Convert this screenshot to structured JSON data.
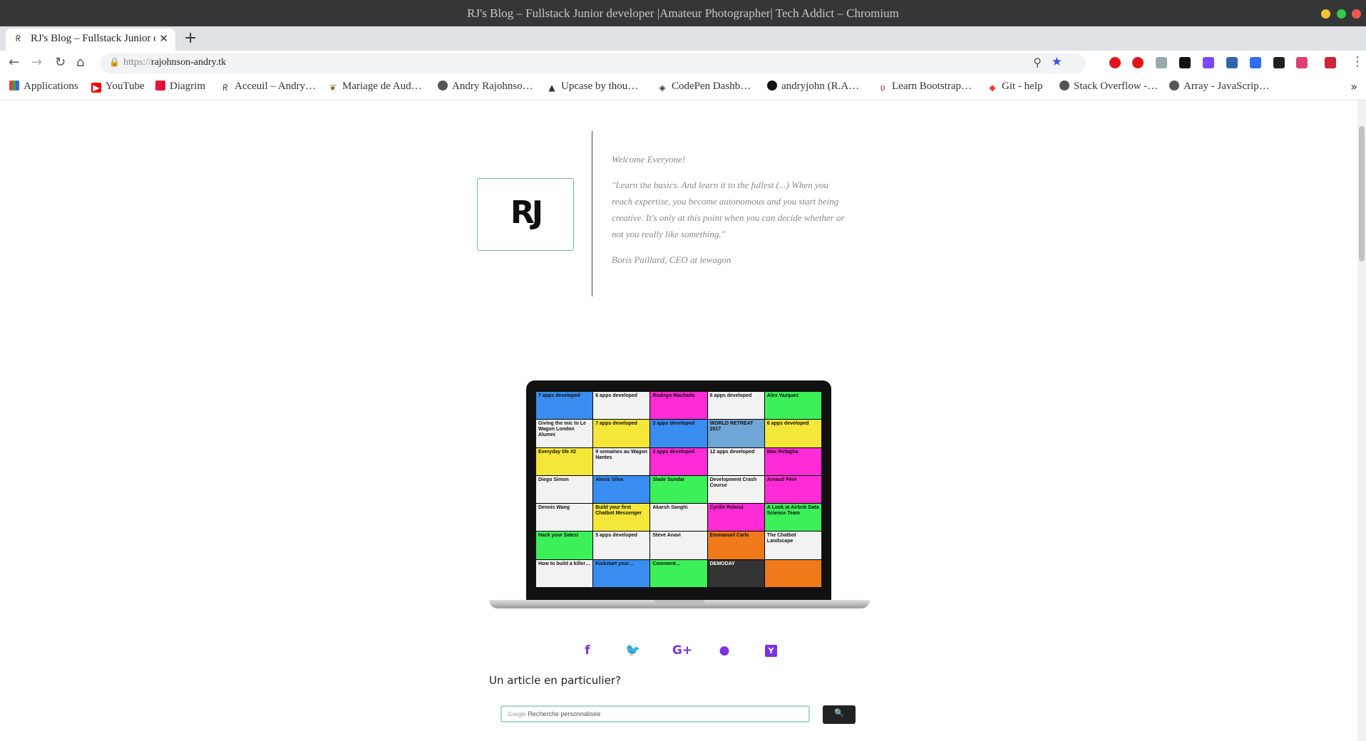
{
  "window": {
    "title": "RJ's Blog – Fullstack Junior developer  |Amateur Photographer| Tech Addict – Chromium",
    "controls": {
      "minimize_color": "#f5c12e",
      "maximize_color": "#37c84c",
      "close_color": "#f05a4c"
    }
  },
  "tab": {
    "label": "RJ's Blog – Fullstack Junior developer",
    "favicon": "rj-favicon",
    "close_icon": "close-icon",
    "new_tab_label": "+"
  },
  "toolbar": {
    "url_scheme": "https://",
    "url_host": "rajohnson-andry.tk",
    "back_glyph": "←",
    "forward_glyph": "→",
    "reload_glyph": "↻",
    "home_glyph": "⌂",
    "lock_glyph": "🔒",
    "zoom_glyph": "⚲",
    "star_glyph": "★",
    "menu_glyph": "⋮",
    "accent_color": "#3b50e0"
  },
  "bookmarks": {
    "items": [
      {
        "label": "Applications",
        "icon": "apps-grid-icon"
      },
      {
        "label": "YouTube",
        "icon": "youtube-icon"
      },
      {
        "label": "Diagrim",
        "icon": "diagrim-icon"
      },
      {
        "label": "Acceuil – Andry…",
        "icon": "rj-favicon"
      },
      {
        "label": "Mariage de Aud…",
        "icon": "leaf-icon"
      },
      {
        "label": "Andry Rajohnso…",
        "icon": "globe-icon"
      },
      {
        "label": "Upcase by thou…",
        "icon": "upcase-icon"
      },
      {
        "label": "CodePen Dashb…",
        "icon": "codepen-icon"
      },
      {
        "label": "andryjohn (R.A…",
        "icon": "github-icon"
      },
      {
        "label": "Learn Bootstrap…",
        "icon": "bootstrap-icon"
      },
      {
        "label": "Git - help",
        "icon": "git-icon"
      },
      {
        "label": "Stack Overflow -…",
        "icon": "globe-icon"
      },
      {
        "label": "Array - JavaScrip…",
        "icon": "globe-icon"
      }
    ],
    "more_glyph": "»"
  },
  "hero": {
    "logo_text": "RJ",
    "welcome": "Welcome Everyone!",
    "quote": "\"Learn the basics. And learn it to the fullest (...) When you reach expertise, you become autonomous and you start being creative. It's only at this point when you can decide whether or not you really like something.\"",
    "author": "Boris Paillard, CEO at lewagon"
  },
  "laptop": {
    "cells": [
      {
        "text": "7 apps developed",
        "bg": "#3a8df0"
      },
      {
        "text": "6 apps developed",
        "bg": "#f2f2f2"
      },
      {
        "text": "Rodrigo Machado",
        "bg": "#ff2bd6"
      },
      {
        "text": "6 apps developed",
        "bg": "#f2f2f2"
      },
      {
        "text": "Alex Vazquez",
        "bg": "#3cf05a"
      },
      {
        "text": "Giving the mic to Le Wagon London Alumni",
        "bg": "#f2f2f2"
      },
      {
        "text": "7 apps developed",
        "bg": "#f5e63a"
      },
      {
        "text": "3 apps developed",
        "bg": "#3a8df0"
      },
      {
        "text": "WORLD RETREAT 2017",
        "bg": "#6fa6d6"
      },
      {
        "text": "6 apps developed",
        "bg": "#f5e63a"
      },
      {
        "text": "Everyday life #2",
        "bg": "#f5e63a"
      },
      {
        "text": "9 semaines au Wagon Nantes",
        "bg": "#f2f2f2"
      },
      {
        "text": "3 apps developed",
        "bg": "#ff2bd6"
      },
      {
        "text": "12 apps developed",
        "bg": "#f2f2f2"
      },
      {
        "text": "Max Rofagha",
        "bg": "#ff2bd6"
      },
      {
        "text": "Diego Simon",
        "bg": "#f2f2f2"
      },
      {
        "text": "Alexis Silva",
        "bg": "#3a8df0"
      },
      {
        "text": "Slade Sundar",
        "bg": "#3cf05a"
      },
      {
        "text": "Development Crash Course",
        "bg": "#f2f2f2"
      },
      {
        "text": "Arnaud Père",
        "bg": "#ff2bd6"
      },
      {
        "text": "Dennis Wang",
        "bg": "#f2f2f2"
      },
      {
        "text": "Build your first Chatbot Messenger",
        "bg": "#f5e63a"
      },
      {
        "text": "Akarsh Sanghi",
        "bg": "#f2f2f2"
      },
      {
        "text": "Cyrille Reboul",
        "bg": "#ff2bd6"
      },
      {
        "text": "A Look at Airbnb Data Science Team",
        "bg": "#3cf05a"
      },
      {
        "text": "Hack your Sales!",
        "bg": "#3cf05a"
      },
      {
        "text": "5 apps developed",
        "bg": "#f2f2f2"
      },
      {
        "text": "Steve Anavi",
        "bg": "#f2f2f2"
      },
      {
        "text": "Emmanuel Carle",
        "bg": "#f07a1a"
      },
      {
        "text": "The Chatbot Landscape",
        "bg": "#f2f2f2"
      },
      {
        "text": "How to build a killer…",
        "bg": "#f2f2f2"
      },
      {
        "text": "Kickstart your…",
        "bg": "#3a8df0"
      },
      {
        "text": "Comment…",
        "bg": "#3cf05a"
      },
      {
        "text": "DEMODAY",
        "bg": "#333333"
      },
      {
        "text": "",
        "bg": "#f07a1a"
      }
    ]
  },
  "social": {
    "facebook": "f",
    "twitter": "🐦",
    "googleplus": "G+",
    "reddit": "●",
    "hackernews": "Y",
    "color": "#7a33e6"
  },
  "search": {
    "question": "Un article en particulier?",
    "google_label": "Google",
    "placeholder": "Recherche personnalisée",
    "button_glyph": "🔍"
  }
}
